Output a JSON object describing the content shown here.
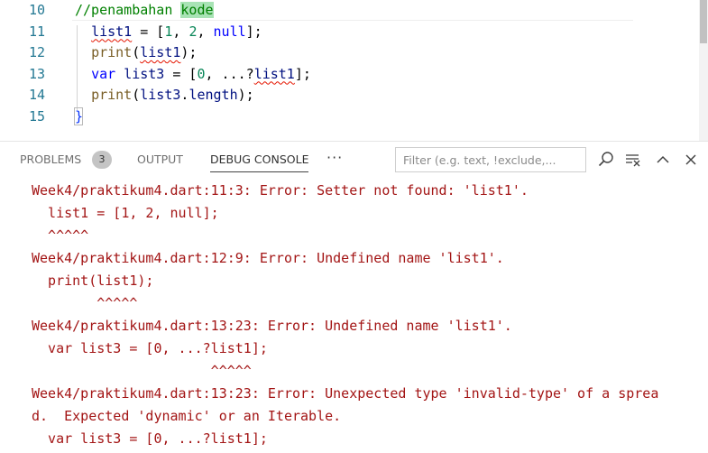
{
  "editor": {
    "lines": [
      {
        "number": "10",
        "segments": [
          {
            "text": "//penambahan ",
            "cls": "tok-comment"
          },
          {
            "text": "kode",
            "cls": "tok-find"
          }
        ]
      },
      {
        "number": "11",
        "segments": [
          {
            "text": "  ",
            "cls": ""
          },
          {
            "text": "list1",
            "cls": "tok-var squiggle"
          },
          {
            "text": " = [",
            "cls": ""
          },
          {
            "text": "1",
            "cls": "tok-num"
          },
          {
            "text": ", ",
            "cls": ""
          },
          {
            "text": "2",
            "cls": "tok-num"
          },
          {
            "text": ", ",
            "cls": ""
          },
          {
            "text": "null",
            "cls": "tok-kw"
          },
          {
            "text": "];",
            "cls": ""
          }
        ]
      },
      {
        "number": "12",
        "segments": [
          {
            "text": "  ",
            "cls": ""
          },
          {
            "text": "print",
            "cls": "tok-fn"
          },
          {
            "text": "(",
            "cls": ""
          },
          {
            "text": "list1",
            "cls": "tok-var squiggle"
          },
          {
            "text": ");",
            "cls": ""
          }
        ]
      },
      {
        "number": "13",
        "segments": [
          {
            "text": "  ",
            "cls": ""
          },
          {
            "text": "var",
            "cls": "tok-kw"
          },
          {
            "text": " ",
            "cls": ""
          },
          {
            "text": "list3",
            "cls": "tok-var"
          },
          {
            "text": " = [",
            "cls": ""
          },
          {
            "text": "0",
            "cls": "tok-num"
          },
          {
            "text": ", ...?",
            "cls": ""
          },
          {
            "text": "list1",
            "cls": "tok-var squiggle"
          },
          {
            "text": "];",
            "cls": ""
          }
        ]
      },
      {
        "number": "14",
        "segments": [
          {
            "text": "  ",
            "cls": ""
          },
          {
            "text": "print",
            "cls": "tok-fn"
          },
          {
            "text": "(",
            "cls": ""
          },
          {
            "text": "list3",
            "cls": "tok-var"
          },
          {
            "text": ".",
            "cls": ""
          },
          {
            "text": "length",
            "cls": "tok-var"
          },
          {
            "text": ");",
            "cls": ""
          }
        ]
      },
      {
        "number": "15",
        "segments": [
          {
            "text": "}",
            "cls": "tok-brace"
          }
        ]
      }
    ]
  },
  "panel": {
    "tabs": {
      "problems": "PROBLEMS",
      "problems_count": "3",
      "output": "OUTPUT",
      "debug_console": "DEBUG CONSOLE"
    },
    "more": "···",
    "filter_placeholder": "Filter (e.g. text, !exclude,..."
  },
  "console": {
    "lines": [
      "Week4/praktikum4.dart:11:3: Error: Setter not found: 'list1'.",
      "  list1 = [1, 2, null];",
      "  ^^^^^",
      "Week4/praktikum4.dart:12:9: Error: Undefined name 'list1'.",
      "  print(list1);",
      "        ^^^^^",
      "Week4/praktikum4.dart:13:23: Error: Undefined name 'list1'.",
      "  var list3 = [0, ...?list1];",
      "                      ^^^^^",
      "Week4/praktikum4.dart:13:23: Error: Unexpected type 'invalid-type' of a sprea",
      "d.  Expected 'dynamic' or an Iterable.",
      "  var list3 = [0, ...?list1];"
    ]
  },
  "colors": {
    "error_text": "#a31515",
    "line_number": "#237893",
    "comment": "#008000"
  }
}
